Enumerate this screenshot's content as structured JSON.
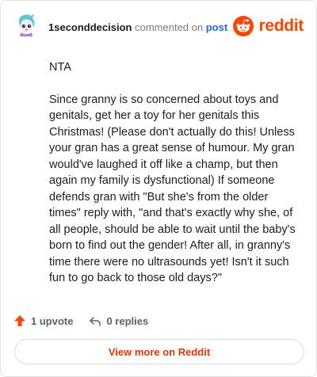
{
  "comment": {
    "username": "1seconddecision",
    "action_text": "commented on",
    "post_link": "post",
    "paragraphs": [
      "NTA",
      "Since granny is so concerned about toys and genitals, get her a toy for her genitals this Christmas! (Please don't actually do this! Unless your gran has a great sense of humour. My gran would've laughed it off like a champ, but then again my family is dysfunctional) If someone defends gran with \"But she's from the older times\" reply with, \"and that's exactly why she, of all people, should be able to wait until the baby's born to find out the gender! After all, in granny's time there were no ultrasounds yet! Isn't it such fun to go back to those old days?\""
    ]
  },
  "brand": {
    "name": "reddit",
    "icon": "reddit-logo-icon",
    "color": "#ff4500"
  },
  "actions": {
    "upvotes": "1 upvote",
    "replies": "0 replies"
  },
  "cta": {
    "label": "View more on Reddit"
  },
  "colors": {
    "accent": "#ff4500",
    "link": "#1c6fd1",
    "cta_text": "#d93a00"
  }
}
